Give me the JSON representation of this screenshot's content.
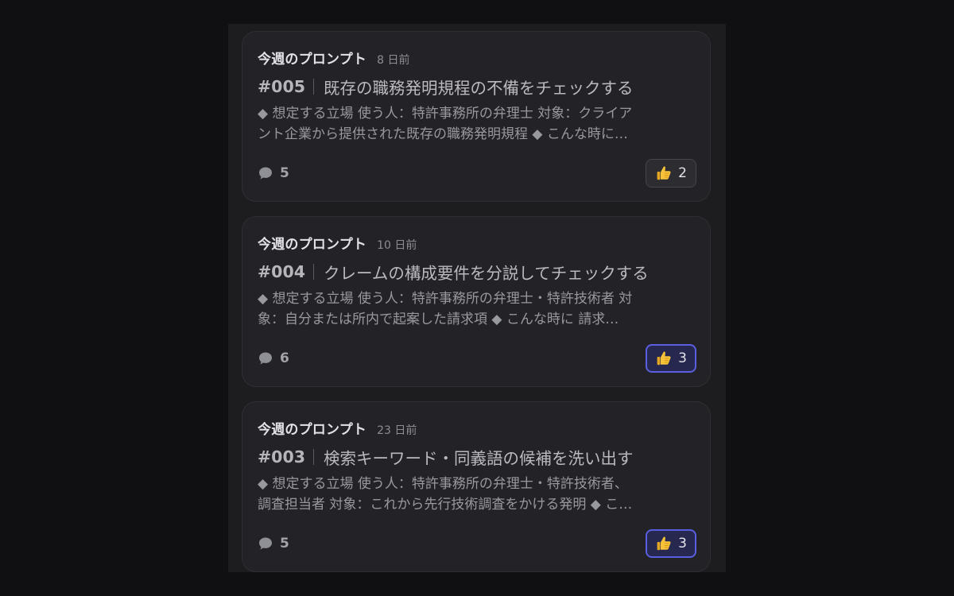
{
  "posts": [
    {
      "category": "今週のプロンプト",
      "time_ago": "8 日前",
      "number": "#005",
      "title": "既存の職務発明規程の不備をチェックする",
      "excerpt_line1": "◆ 想定する立場 使う人：特許事務所の弁理士 対象：クライア",
      "excerpt_line2": "ント企業から提供された既存の職務発明規程 ◆ こんな時に…",
      "comment_count": "5",
      "like_count": "2",
      "liked": false
    },
    {
      "category": "今週のプロンプト",
      "time_ago": "10 日前",
      "number": "#004",
      "title": "クレームの構成要件を分説してチェックする",
      "excerpt_line1": "◆ 想定する立場 使う人：特許事務所の弁理士・特許技術者 対",
      "excerpt_line2": "象：自分または所内で起案した請求項 ◆ こんな時に 請求…",
      "comment_count": "6",
      "like_count": "3",
      "liked": true
    },
    {
      "category": "今週のプロンプト",
      "time_ago": "23 日前",
      "number": "#003",
      "title": "検索キーワード・同義語の候補を洗い出す",
      "excerpt_line1": "◆ 想定する立場 使う人：特許事務所の弁理士・特許技術者、",
      "excerpt_line2": "調査担当者 対象：これから先行技術調査をかける発明 ◆ こ…",
      "comment_count": "5",
      "like_count": "3",
      "liked": true
    }
  ],
  "icons": {
    "comment": "speech-bubble-icon",
    "like": "thumbs-up-icon"
  },
  "colors": {
    "background": "#101012",
    "panel": "#1d1d20",
    "card": "#232327",
    "like_active_border": "#5a5fe0",
    "like_active_fill": "#272850"
  }
}
